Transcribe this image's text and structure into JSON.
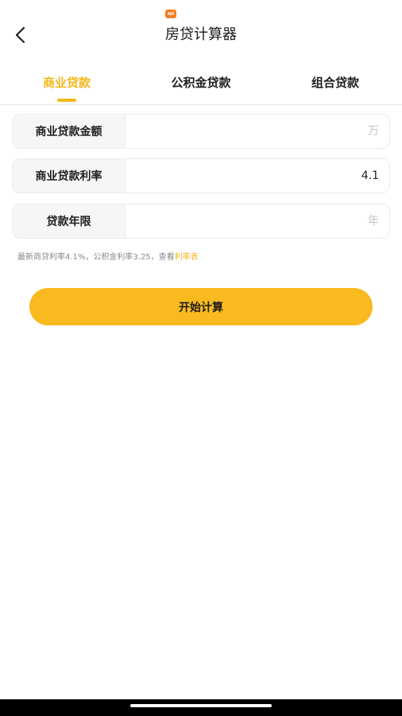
{
  "status_badge": {
    "text": "mi",
    "color": "#f07d23"
  },
  "header": {
    "back_icon": "chevron-left-icon",
    "title": "房贷计算器"
  },
  "tabs": [
    {
      "label": "商业贷款",
      "active": true
    },
    {
      "label": "公积金贷款",
      "active": false
    },
    {
      "label": "组合贷款",
      "active": false
    }
  ],
  "form": {
    "amount": {
      "label": "商业贷款金额",
      "value": "",
      "placeholder": "万"
    },
    "rate": {
      "label": "商业贷款利率",
      "value": "4.1",
      "placeholder": ""
    },
    "years": {
      "label": "贷款年限",
      "value": "",
      "placeholder": "年"
    }
  },
  "hint": {
    "text": "最新商贷利率4.1%，公积金利率3.25，查看",
    "link": "利率表"
  },
  "start_button": {
    "label": "开始计算"
  },
  "colors": {
    "accent": "#f4b71c",
    "button": "#f8ba1f",
    "label_bg": "#f6f6f6"
  }
}
